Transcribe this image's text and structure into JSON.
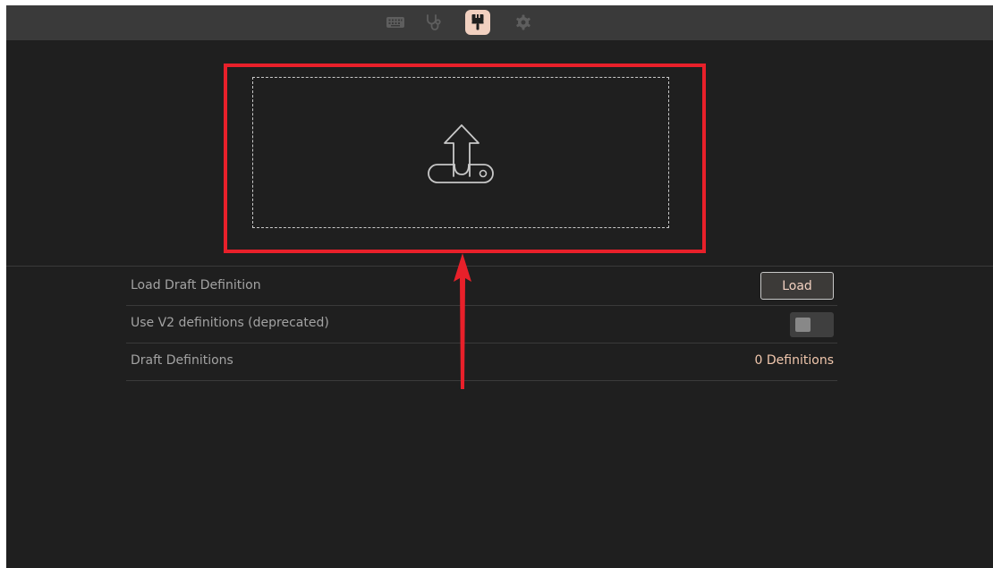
{
  "toolbar": {
    "tabs": [
      {
        "icon": "keyboard-icon",
        "active": false
      },
      {
        "icon": "stethoscope-icon",
        "active": false
      },
      {
        "icon": "paintbrush-icon",
        "active": true
      },
      {
        "icon": "gear-icon",
        "active": false
      }
    ]
  },
  "upload": {
    "icon": "upload-tray-icon"
  },
  "settings": {
    "load_draft_label": "Load Draft Definition",
    "load_button_label": "Load",
    "use_v2_label": "Use V2 definitions (deprecated)",
    "use_v2_enabled": false,
    "draft_definitions_label": "Draft Definitions",
    "draft_definitions_value": "0 Definitions"
  },
  "colors": {
    "background": "#1f1f1f",
    "topbar": "#3a3a3a",
    "accent": "#f1d0c0",
    "value_text": "#f1c7ad",
    "highlight_annotation": "#e8202a"
  }
}
